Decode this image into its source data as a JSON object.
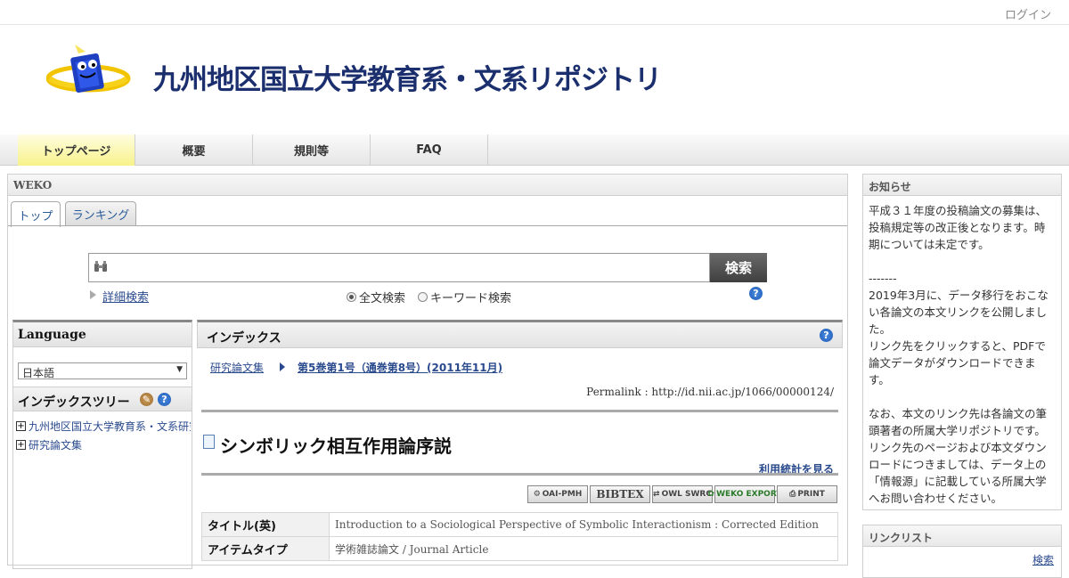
{
  "header": {
    "login": "ログイン",
    "site_title": "九州地区国立大学教育系・文系リポジトリ"
  },
  "nav": {
    "items": [
      "トップページ",
      "概要",
      "規則等",
      "FAQ"
    ]
  },
  "main": {
    "panel_title": "WEKO",
    "tabs": [
      "トップ",
      "ランキング"
    ],
    "search": {
      "placeholder": "",
      "button": "検索",
      "advanced": "詳細検索",
      "mode_fulltext": "全文検索",
      "mode_keyword": "キーワード検索"
    },
    "language": {
      "heading": "Language",
      "selected": "日本語"
    },
    "index_tree": {
      "heading": "インデックスツリー",
      "items": [
        "九州地区国立大学教育系・文系研究論文",
        "研究論文集"
      ]
    },
    "index": {
      "heading": "インデックス",
      "crumb1": "研究論文集",
      "crumb2": "第5巻第1号（通巻第8号）(2011年11月)",
      "permalink": "Permalink : http://id.nii.ac.jp/1066/00000124/",
      "title": "シンボリック相互作用論序説",
      "stats": "利用統計を見る",
      "exports": [
        "OAI-PMH",
        "BIBTEX",
        "OWL SWRC",
        "WEKO EXPORT",
        "PRINT"
      ],
      "rows": [
        {
          "key": "タイトル(英)",
          "value": "Introduction to a Sociological Perspective of Symbolic Interactionism : Corrected Edition"
        },
        {
          "key": "アイテムタイプ",
          "value": "学術雑誌論文 / Journal Article"
        }
      ]
    }
  },
  "sidebar": {
    "news_title": "お知らせ",
    "news_body": "平成３１年度の投稿論文の募集は、投稿規定等の改正後となります。時期については未定です。\n\n-------\n2019年3月に、データ移行をおこない各論文の本文リンクを公開しました。\nリンク先をクリックすると、PDFで論文データがダウンロードできます。\n\nなお、本文のリンク先は各論文の筆頭著者の所属大学リポジトリです。リンク先のページおよび本文ダウンロードにつきましては、データ上の「情報源」に記載している所属大学へお問い合わせください。",
    "links_title": "リンクリスト",
    "links_more": "検索"
  },
  "colors": {
    "accent": "#1b2f6e",
    "link": "#2a4a8e",
    "active_tab": "#f7f28a"
  }
}
